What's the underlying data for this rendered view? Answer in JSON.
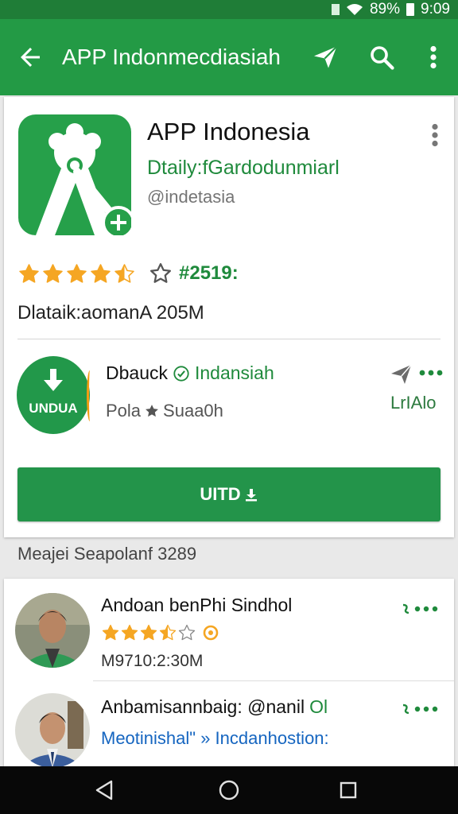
{
  "status_bar": {
    "battery_percent": "89%",
    "time": "9:09"
  },
  "app_bar": {
    "title": "APP Indonmecdiasiah"
  },
  "app": {
    "title": "APP Indonesia",
    "developer": "Dtaily:fGardodunmiarl",
    "handle": "@indetasia",
    "rating": 4.5,
    "rating_count": "#2519:",
    "size_line": "Dlataik:aomanA 205M"
  },
  "download": {
    "circle_label": "UNDUA",
    "publisher_name": "Dbauck",
    "publisher_link": "Indansiah",
    "publisher_sub_left": "Pola",
    "publisher_sub_right": "Suaa0h",
    "side_label": "LrIAlo"
  },
  "install_button": {
    "label": "UITD"
  },
  "reviews": {
    "section_header": "Meajei Seapolanf 3289",
    "items": [
      {
        "name": "Andoan benPhi Sindhol",
        "rating": 3.5,
        "meta": "M9710:2:30M",
        "more_label": "•••"
      },
      {
        "name": "Anbamisannbaig: @nanil",
        "badge": "Ol",
        "subtitle": "Meotinishal\" » Incdanhostion:",
        "more_label": "•••"
      }
    ]
  },
  "colors": {
    "status_bar": "#1f7d37",
    "app_bar": "#239a45",
    "accent_green": "#23944a",
    "star": "#f5a623",
    "link_blue": "#1565c0",
    "nav_bar": "#080808"
  },
  "icons": [
    "back-arrow-icon",
    "send-icon",
    "search-icon",
    "more-vert-icon",
    "download-icon",
    "verified-icon",
    "share-icon",
    "star-icon",
    "nav-back-icon",
    "nav-home-icon",
    "nav-recents-icon"
  ]
}
